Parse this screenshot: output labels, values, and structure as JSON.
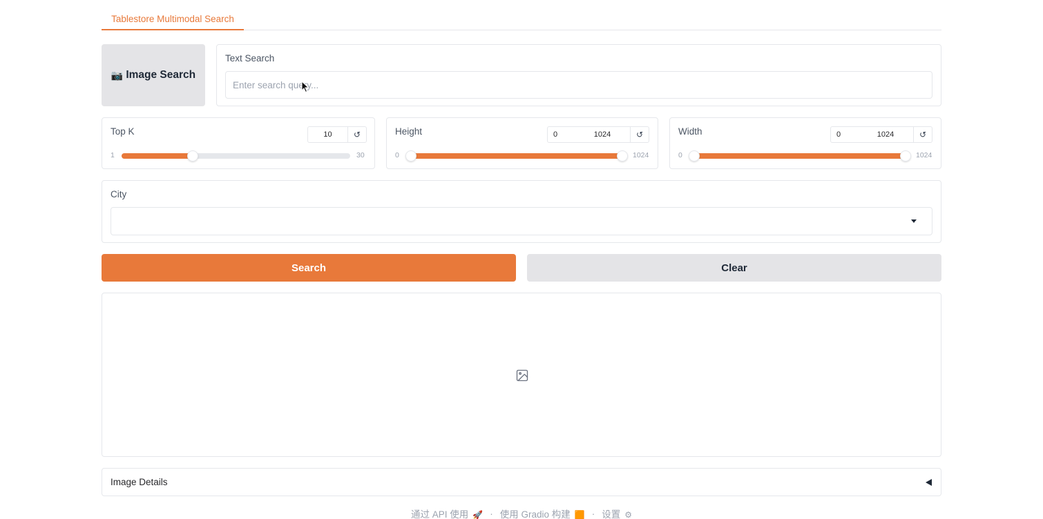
{
  "tabs": [
    {
      "label": "Tablestore Multimodal Search",
      "active": true
    }
  ],
  "image_search_button": {
    "icon": "camera-icon",
    "icon_glyph": "📷",
    "label": "Image Search"
  },
  "text_search": {
    "label": "Text Search",
    "value": "",
    "placeholder": "Enter search query..."
  },
  "sliders": {
    "top_k": {
      "label": "Top K",
      "value": "10",
      "min": "1",
      "max": "30",
      "fraction": 0.31
    },
    "height": {
      "label": "Height",
      "value_min": "0",
      "value_max": "1024",
      "min": "0",
      "max": "1024"
    },
    "width": {
      "label": "Width",
      "value_min": "0",
      "value_max": "1024",
      "min": "0",
      "max": "1024"
    }
  },
  "reset_icon": "↺",
  "city": {
    "label": "City",
    "value": ""
  },
  "buttons": {
    "search": "Search",
    "clear": "Clear"
  },
  "gallery": {
    "icon": "image-icon"
  },
  "accordion": {
    "label": "Image Details"
  },
  "footer": {
    "api": "通过 API 使用",
    "api_icon": "🚀",
    "built": "使用 Gradio 构建",
    "built_icon": "🟧",
    "settings": "设置",
    "settings_icon": "⚙",
    "separator": "·"
  },
  "colors": {
    "accent": "#e8793a",
    "secondary_button": "#e4e4e7",
    "border": "#e5e7eb"
  }
}
